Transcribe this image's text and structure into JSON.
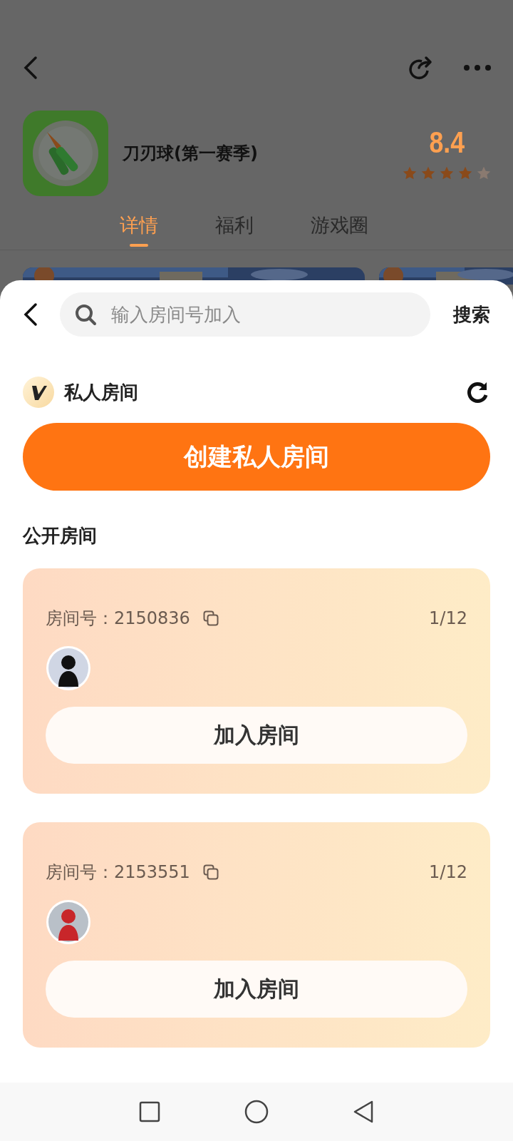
{
  "app": {
    "name": "刀刃球(第一赛季)",
    "rating": "8.4",
    "stars": 4
  },
  "tabs": [
    {
      "label": "详情",
      "selected": true
    },
    {
      "label": "福利",
      "selected": false
    },
    {
      "label": "游戏圈",
      "selected": false
    }
  ],
  "sheet": {
    "search": {
      "placeholder": "输入房间号加入"
    },
    "search_button": "搜索",
    "private_title": "私人房间",
    "create_button": "创建私人房间",
    "public_title": "公开房间",
    "rooms": [
      {
        "room_label": "房间号：2150836",
        "count": "1/12",
        "join_button": "加入房间"
      },
      {
        "room_label": "房间号：2153551",
        "count": "1/12",
        "join_button": "加入房间"
      }
    ]
  }
}
